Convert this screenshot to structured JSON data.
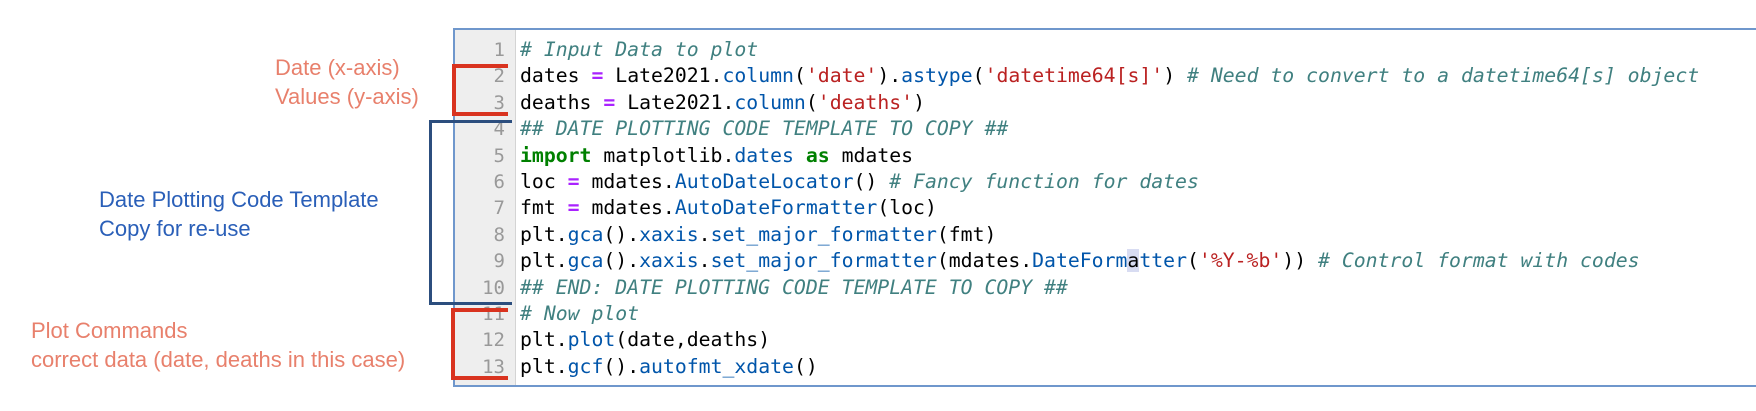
{
  "annotations": {
    "data_axes": [
      "Date (x-axis)",
      "Values (y-axis)"
    ],
    "template": [
      "Date Plotting Code Template",
      "Copy for re-use"
    ],
    "plot": [
      "Plot Commands",
      "correct data (date, deaths in this case)"
    ]
  },
  "editor": {
    "line_numbers": [
      "1",
      "2",
      "3",
      "4",
      "5",
      "6",
      "7",
      "8",
      "9",
      "10",
      "11",
      "12",
      "13"
    ],
    "lines": [
      [
        {
          "t": "cm",
          "v": "# Input Data to plot"
        }
      ],
      [
        {
          "t": "",
          "v": "dates "
        },
        {
          "t": "op",
          "v": "="
        },
        {
          "t": "",
          "v": " Late2021."
        },
        {
          "t": "at",
          "v": "column"
        },
        {
          "t": "",
          "v": "("
        },
        {
          "t": "st",
          "v": "'date'"
        },
        {
          "t": "",
          "v": ")."
        },
        {
          "t": "at",
          "v": "astype"
        },
        {
          "t": "",
          "v": "("
        },
        {
          "t": "st",
          "v": "'datetime64[s]'"
        },
        {
          "t": "",
          "v": ") "
        },
        {
          "t": "cm",
          "v": "# Need to convert to a datetime64[s] object"
        }
      ],
      [
        {
          "t": "",
          "v": "deaths "
        },
        {
          "t": "op",
          "v": "="
        },
        {
          "t": "",
          "v": " Late2021."
        },
        {
          "t": "at",
          "v": "column"
        },
        {
          "t": "",
          "v": "("
        },
        {
          "t": "st",
          "v": "'deaths'"
        },
        {
          "t": "",
          "v": ")"
        }
      ],
      [
        {
          "t": "cm",
          "v": "## DATE PLOTTING CODE TEMPLATE TO COPY ##"
        }
      ],
      [
        {
          "t": "kw",
          "v": "import"
        },
        {
          "t": "",
          "v": " matplotlib."
        },
        {
          "t": "at",
          "v": "dates"
        },
        {
          "t": "",
          "v": " "
        },
        {
          "t": "kw",
          "v": "as"
        },
        {
          "t": "",
          "v": " mdates"
        }
      ],
      [
        {
          "t": "",
          "v": "loc "
        },
        {
          "t": "op",
          "v": "="
        },
        {
          "t": "",
          "v": " mdates."
        },
        {
          "t": "at",
          "v": "AutoDateLocator"
        },
        {
          "t": "",
          "v": "() "
        },
        {
          "t": "cm",
          "v": "# Fancy function for dates"
        }
      ],
      [
        {
          "t": "",
          "v": "fmt "
        },
        {
          "t": "op",
          "v": "="
        },
        {
          "t": "",
          "v": " mdates."
        },
        {
          "t": "at",
          "v": "AutoDateFormatter"
        },
        {
          "t": "",
          "v": "(loc)"
        }
      ],
      [
        {
          "t": "",
          "v": "plt."
        },
        {
          "t": "at",
          "v": "gca"
        },
        {
          "t": "",
          "v": "()."
        },
        {
          "t": "at",
          "v": "xaxis"
        },
        {
          "t": "",
          "v": "."
        },
        {
          "t": "at",
          "v": "set_major_formatter"
        },
        {
          "t": "",
          "v": "(fmt)"
        }
      ],
      [
        {
          "t": "",
          "v": "plt."
        },
        {
          "t": "at",
          "v": "gca"
        },
        {
          "t": "",
          "v": "()."
        },
        {
          "t": "at",
          "v": "xaxis"
        },
        {
          "t": "",
          "v": "."
        },
        {
          "t": "at",
          "v": "set_major_formatter"
        },
        {
          "t": "",
          "v": "(mdates."
        },
        {
          "t": "at",
          "v": "DateForm"
        },
        {
          "t": "hl",
          "v": "a"
        },
        {
          "t": "at",
          "v": "tter"
        },
        {
          "t": "",
          "v": "("
        },
        {
          "t": "st",
          "v": "'%Y-%b'"
        },
        {
          "t": "",
          "v": ")) "
        },
        {
          "t": "cm",
          "v": "# Control format with codes"
        }
      ],
      [
        {
          "t": "cm",
          "v": "## END: DATE PLOTTING CODE TEMPLATE TO COPY ##"
        }
      ],
      [
        {
          "t": "cm",
          "v": "# Now plot"
        }
      ],
      [
        {
          "t": "",
          "v": "plt."
        },
        {
          "t": "at",
          "v": "plot"
        },
        {
          "t": "",
          "v": "(date,deaths)"
        }
      ],
      [
        {
          "t": "",
          "v": "plt."
        },
        {
          "t": "at",
          "v": "gcf"
        },
        {
          "t": "",
          "v": "()."
        },
        {
          "t": "at",
          "v": "autofmt_xdate"
        },
        {
          "t": "",
          "v": "()"
        }
      ]
    ]
  },
  "colors": {
    "annotation_red": "#e8806c",
    "annotation_blue": "#2a5fb8",
    "bracket_red": "#d9331f",
    "bracket_blue": "#2c4e7e",
    "editor_border": "#6f97cc"
  }
}
